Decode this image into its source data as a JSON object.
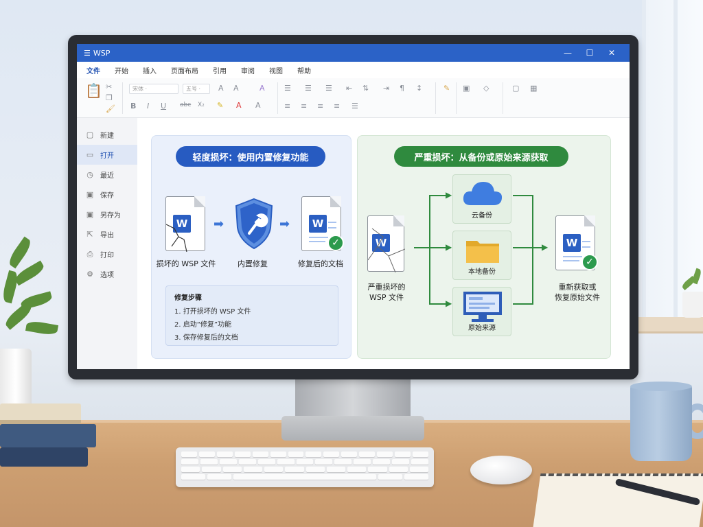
{
  "app": {
    "title": "WSP",
    "window_buttons": {
      "minimize": "—",
      "maximize": "☐",
      "close": "✕"
    }
  },
  "menu": {
    "items": [
      "文件",
      "开始",
      "插入",
      "页面布局",
      "引用",
      "审阅",
      "视图",
      "帮助"
    ],
    "active": "文件"
  },
  "ribbon": {
    "font_select": "宋体 ·",
    "size_select": "五号 ·",
    "format_buttons": [
      "B",
      "I",
      "U",
      "abc",
      "X₂"
    ]
  },
  "sidebar": {
    "items": [
      {
        "label": "新建",
        "icon": "new-doc-icon",
        "active": false
      },
      {
        "label": "打开",
        "icon": "folder-open-icon",
        "active": true
      },
      {
        "label": "最近",
        "icon": "clock-icon",
        "active": false
      },
      {
        "label": "保存",
        "icon": "save-icon",
        "active": false
      },
      {
        "label": "另存为",
        "icon": "save-as-icon",
        "active": false
      },
      {
        "label": "导出",
        "icon": "export-icon",
        "active": false
      },
      {
        "label": "打印",
        "icon": "printer-icon",
        "active": false
      },
      {
        "label": "选项",
        "icon": "gear-icon",
        "active": false
      }
    ]
  },
  "mild": {
    "title": "轻度损坏：使用内置修复功能",
    "damaged_label": "损坏的 WSP 文件",
    "repair_label": "内置修复",
    "repaired_label": "修复后的文档",
    "steps_title": "修复步骤",
    "steps": [
      "1. 打开损坏的 WSP 文件",
      "2. 启动“修复”功能",
      "3. 保存修复后的文档"
    ]
  },
  "severe": {
    "title": "严重损坏：从备份或原始来源获取",
    "damaged_label_1": "严重损坏的",
    "damaged_label_2": "WSP 文件",
    "sources": [
      "云备份",
      "本地备份",
      "原始来源"
    ],
    "result_label_1": "重新获取或",
    "result_label_2": "恢复原始文件"
  },
  "colors": {
    "titlebar": "#2b62c7",
    "accent_blue": "#275bc1",
    "accent_green": "#2f8a3e",
    "check_green": "#2c9a4d"
  }
}
